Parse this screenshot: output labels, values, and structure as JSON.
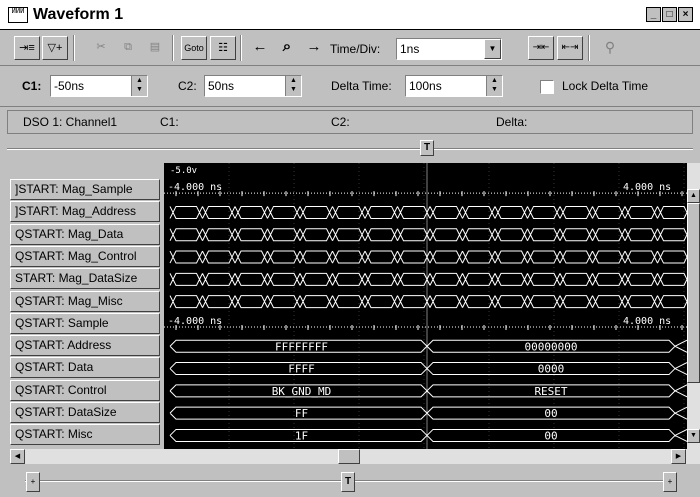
{
  "window": {
    "title": "Waveform 1",
    "icon_text": "ИИИ"
  },
  "controls": {
    "minimize": "_",
    "maximize": "□",
    "close": "×"
  },
  "toolbar": {
    "buttons": [
      {
        "name": "add-marker",
        "glyph": "⇥≡"
      },
      {
        "name": "add-signal",
        "glyph": "▽+"
      },
      {
        "name": "cut",
        "glyph": "✂"
      },
      {
        "name": "copy",
        "glyph": "⧉"
      },
      {
        "name": "paste",
        "glyph": "▤"
      },
      {
        "name": "goto",
        "glyph": "Goto"
      },
      {
        "name": "properties",
        "glyph": "☷"
      },
      {
        "name": "prev",
        "glyph": "←"
      },
      {
        "name": "find",
        "glyph": "⌕"
      },
      {
        "name": "next",
        "glyph": "→"
      }
    ],
    "time_div_label": "Time/Div:",
    "time_div_value": "1ns",
    "zoom_buttons": [
      "⇥⇤",
      "⇤⇥",
      "⚲"
    ]
  },
  "cursors": {
    "c1_label": "C1:",
    "c1_value": "-50ns",
    "c2_label": "C2:",
    "c2_value": "50ns",
    "delta_label": "Delta Time:",
    "delta_value": "100ns",
    "lock_label": "Lock Delta Time"
  },
  "info": {
    "source": "DSO 1: Channel1",
    "c1": "C1:",
    "c2": "C2:",
    "delta": "Delta:"
  },
  "signals": [
    {
      "name": "]START: Mag_Sample",
      "kind": "analog",
      "label_left": "-4.000 ns",
      "label_right": "4.000 ns",
      "top_label": "-5.0v"
    },
    {
      "name": "]START: Mag_Address",
      "kind": "eye"
    },
    {
      "name": "QSTART: Mag_Data",
      "kind": "eye"
    },
    {
      "name": "QSTART: Mag_Control",
      "kind": "eye"
    },
    {
      "name": "START: Mag_DataSize",
      "kind": "eye"
    },
    {
      "name": "QSTART: Mag_Misc",
      "kind": "eye"
    },
    {
      "name": "QSTART: Sample",
      "kind": "analog2",
      "label_left": "-4.000 ns",
      "label_right": "4.000 ns"
    },
    {
      "name": "QSTART: Address",
      "kind": "bus",
      "v1": "FFFFFFFF",
      "v2": "00000000"
    },
    {
      "name": "QSTART: Data",
      "kind": "bus",
      "v1": "FFFF",
      "v2": "0000"
    },
    {
      "name": "QSTART: Control",
      "kind": "bus",
      "v1": "BK_GND_MD",
      "v2": "RESET"
    },
    {
      "name": "QSTART: DataSize",
      "kind": "bus",
      "v1": "FF",
      "v2": "00"
    },
    {
      "name": "QSTART: Misc",
      "kind": "bus",
      "v1": "1F",
      "v2": "00"
    }
  ],
  "markers": {
    "top": "T",
    "bottom": "T"
  },
  "colors": {
    "wave": "#ffffff",
    "background": "#000000",
    "grid": "#808080"
  }
}
